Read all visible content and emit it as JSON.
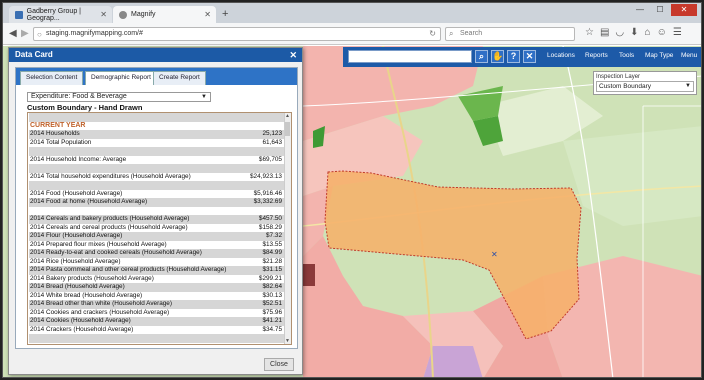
{
  "browser": {
    "tabs": [
      {
        "label": "Gadberry Group | Geograp...",
        "active": false
      },
      {
        "label": "Magnify",
        "active": true
      }
    ],
    "url": "staging.magnifymapping.com/#",
    "search_placeholder": "Search"
  },
  "app": {
    "menu": [
      "Locations",
      "Reports",
      "Tools",
      "Map Type",
      "Menu"
    ],
    "inspection_layer": {
      "label": "Inspection Layer",
      "value": "Custom Boundary"
    }
  },
  "card": {
    "title": "Data Card",
    "tabs": [
      "Selection Content",
      "Demographic Report",
      "Create Report"
    ],
    "active_tab": "Demographic Report",
    "dropdown": "Expenditure: Food & Beverage",
    "boundary": "Custom Boundary - Hand Drawn",
    "close_label": "Close",
    "rows": [
      {
        "label": "",
        "value": "",
        "shade": true
      },
      {
        "label": "CURRENT YEAR",
        "value": "",
        "section": true
      },
      {
        "label": "2014 Households",
        "value": "25,123",
        "shade": true
      },
      {
        "label": "2014 Total Population",
        "value": "61,643",
        "shade": false
      },
      {
        "label": "",
        "value": "",
        "shade": true
      },
      {
        "label": "2014 Household Income: Average",
        "value": "$69,705",
        "shade": false
      },
      {
        "label": "",
        "value": "",
        "shade": true
      },
      {
        "label": "2014 Total household expenditures (Household Average)",
        "value": "$24,923.13",
        "shade": false
      },
      {
        "label": "",
        "value": "",
        "shade": true
      },
      {
        "label": "2014 Food (Household Average)",
        "value": "$5,916.46",
        "shade": false
      },
      {
        "label": "2014 Food at home (Household Average)",
        "value": "$3,332.69",
        "shade": true
      },
      {
        "label": "",
        "value": "",
        "shade": false
      },
      {
        "label": "2014 Cereals and bakery products (Household Average)",
        "value": "$457.50",
        "shade": true
      },
      {
        "label": "2014 Cereals and cereal products (Household Average)",
        "value": "$158.29",
        "shade": false
      },
      {
        "label": "2014 Flour (Household Average)",
        "value": "$7.32",
        "shade": true
      },
      {
        "label": "2014 Prepared flour mixes (Household Average)",
        "value": "$13.55",
        "shade": false
      },
      {
        "label": "2014 Ready-to-eat and cooked cereals (Household Average)",
        "value": "$84.99",
        "shade": true
      },
      {
        "label": "2014 Rice (Household Average)",
        "value": "$21.28",
        "shade": false
      },
      {
        "label": "2014 Pasta cornmeal and other cereal products (Household Average)",
        "value": "$31.15",
        "shade": true
      },
      {
        "label": "2014 Bakery products (Household Average)",
        "value": "$299.21",
        "shade": false
      },
      {
        "label": "2014 Bread (Household Average)",
        "value": "$82.64",
        "shade": true
      },
      {
        "label": "2014 White bread (Household Average)",
        "value": "$30.13",
        "shade": false
      },
      {
        "label": "2014 Bread other than white (Household Average)",
        "value": "$52.51",
        "shade": true
      },
      {
        "label": "2014 Cookies and crackers (Household Average)",
        "value": "$75.96",
        "shade": false
      },
      {
        "label": "2014 Cookies (Household Average)",
        "value": "$41.21",
        "shade": true
      },
      {
        "label": "2014 Crackers (Household Average)",
        "value": "$34.75",
        "shade": false
      },
      {
        "label": "",
        "value": "",
        "shade": true
      }
    ]
  }
}
